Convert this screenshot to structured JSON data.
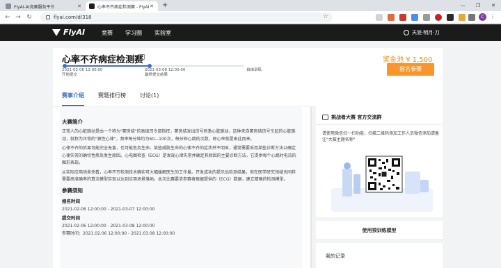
{
  "browser": {
    "tabs": [
      {
        "title": "FlyAI-AI竞赛服务平台"
      },
      {
        "title": "心率不齐病症检测赛 - FlyAI"
      }
    ],
    "new_tab": "+",
    "url": "flyai.com/d/318",
    "avatar_letter": "C"
  },
  "site": {
    "logo": "FlyAI",
    "nav": [
      "竞赛",
      "学习圈",
      "实验室"
    ],
    "username": "天涯·明月·刀"
  },
  "competition": {
    "title": "心率不齐病症检测赛",
    "prize": "奖金池 ¥ 1,500",
    "signup": "报名参赛",
    "timeline": {
      "start_date": "2021-02-06 12:00:00",
      "start_label": "开始提交",
      "end_date": "2021-03-08 12:00:00",
      "end_label": "最终提交结果",
      "final_label": "自由训练",
      "progress": 0.48
    },
    "tabs": [
      "赛事介绍",
      "赛题排行榜",
      "讨论(1)"
    ]
  },
  "intro": {
    "heading": "大赛简介",
    "paragraphs": [
      "正常人的心脏跳动是由一个称为\"窦房结\"的高级司令部指挥，窦房结发出信号刺激心脏跳动，这种来自窦房结信号引起的心脏跳动，就称为正常的\"窦性心律\"，频率每分钟约为60—100次，每分钟心跳的次数，即心率就是由此而来。",
      "心律不齐的后果可能完全无害，也可能危及生命。某些威胁生命的心律不齐的症状并不明显，通常需要采用某些诊断方法以确定心律失常的确切性质及发生原因。心电图检查（ECG）是发现心律失常并确定其病因的主要诊断方法，它提供每个心跳时电流的图形表现。",
      "从实际应用场景来看，心率不齐检测技术确实可大幅缓解医生的工作量。开发成功的提示出检测结果，但在医学研究领域也同样需要高准确率的算法模型实现以达到应用场景落地。本次比赛要求参赛者根据提供的（ECG）数据，建立精确的检测模型。"
    ],
    "notice_heading": "参赛须知",
    "signup_time_label": "报名时间",
    "signup_time": "2021-02-06 12:00:00 - 2021-03-07 12:00:00",
    "submit_time_label": "提交时间",
    "submit_time": "2021-02-06 12:00:00 - 2021-03-08 12:00:00",
    "train_time": "参赛时间：2021.02.06 12:00:00 - 2021.03.08 12:00:00"
  },
  "sidebar": {
    "group_title": "挑战者大赛 官方交流群",
    "group_desc": "请使用微信扫一扫功能，扫描二维码添加工作人员微信添加请备注\"大赛主题名称\"",
    "use_model": "使用预训练模型",
    "my_records": "我的记录"
  },
  "colors": {
    "accent": "#3d6fd0",
    "prize": "#f28a16",
    "signup_button": "#f7962b",
    "header": "#1b1b1b"
  }
}
